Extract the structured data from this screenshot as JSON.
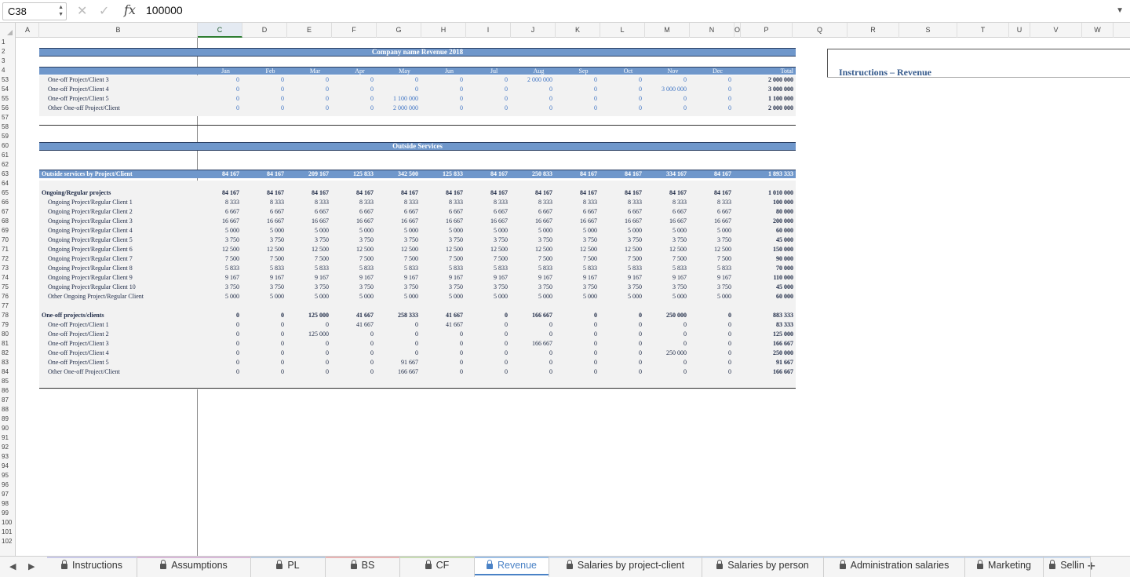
{
  "formula_bar": {
    "cell_ref": "C38",
    "value": "100000",
    "cancel_icon": "close-icon",
    "confirm_icon": "check-icon",
    "fx_label": "fx"
  },
  "columns": [
    "A",
    "B",
    "C",
    "D",
    "E",
    "F",
    "G",
    "H",
    "I",
    "J",
    "K",
    "L",
    "M",
    "N",
    "O",
    "P",
    "Q",
    "R",
    "S",
    "T",
    "U",
    "V",
    "W"
  ],
  "selected_column": "C",
  "rows": [
    "1",
    "2",
    "3",
    "4",
    "53",
    "54",
    "55",
    "56",
    "57",
    "58",
    "59",
    "60",
    "61",
    "62",
    "63",
    "64",
    "65",
    "66",
    "67",
    "68",
    "69",
    "70",
    "71",
    "72",
    "73",
    "74",
    "75",
    "76",
    "77",
    "78",
    "79",
    "80",
    "81",
    "82",
    "83",
    "84",
    "85",
    "86",
    "87",
    "88",
    "89",
    "90",
    "91",
    "92",
    "93",
    "94",
    "95",
    "96",
    "97",
    "98",
    "99",
    "100",
    "101",
    "102"
  ],
  "sheet": {
    "title": "Company name Revenue 2018",
    "months": [
      "Jan",
      "Feb",
      "Mar",
      "Apr",
      "May",
      "Jun",
      "Jul",
      "Aug",
      "Sep",
      "Oct",
      "Nov",
      "Dec",
      "Total"
    ],
    "top_rows": [
      {
        "label": "One-off Project/Client 3",
        "values": [
          "0",
          "0",
          "0",
          "0",
          "0",
          "0",
          "0",
          "2 000 000",
          "0",
          "0",
          "0",
          "0",
          "2 000 000"
        ]
      },
      {
        "label": "One-off Project/Client 4",
        "values": [
          "0",
          "0",
          "0",
          "0",
          "0",
          "0",
          "0",
          "0",
          "0",
          "0",
          "3 000 000",
          "0",
          "3 000 000"
        ]
      },
      {
        "label": "One-off Project/Client 5",
        "values": [
          "0",
          "0",
          "0",
          "0",
          "1 100 000",
          "0",
          "0",
          "0",
          "0",
          "0",
          "0",
          "0",
          "1 100 000"
        ]
      },
      {
        "label": "Other One-off Project/Client",
        "values": [
          "0",
          "0",
          "0",
          "0",
          "2 000 000",
          "0",
          "0",
          "0",
          "0",
          "0",
          "0",
          "0",
          "2 000 000"
        ]
      }
    ],
    "section2_title": "Outside Services",
    "total_row": {
      "label": "Outside services by Project/Client",
      "values": [
        "84 167",
        "84 167",
        "209 167",
        "125 833",
        "342 500",
        "125 833",
        "84 167",
        "250 833",
        "84 167",
        "84 167",
        "334 167",
        "84 167",
        "1 893 333"
      ]
    },
    "ongoing": {
      "label": "Ongoing/Regular projects",
      "values": [
        "84 167",
        "84 167",
        "84 167",
        "84 167",
        "84 167",
        "84 167",
        "84 167",
        "84 167",
        "84 167",
        "84 167",
        "84 167",
        "84 167",
        "1 010 000"
      ],
      "rows": [
        {
          "label": "Ongoing Project/Regular Client 1",
          "values": [
            "8 333",
            "8 333",
            "8 333",
            "8 333",
            "8 333",
            "8 333",
            "8 333",
            "8 333",
            "8 333",
            "8 333",
            "8 333",
            "8 333",
            "100 000"
          ]
        },
        {
          "label": "Ongoing Project/Regular Client 2",
          "values": [
            "6 667",
            "6 667",
            "6 667",
            "6 667",
            "6 667",
            "6 667",
            "6 667",
            "6 667",
            "6 667",
            "6 667",
            "6 667",
            "6 667",
            "80 000"
          ]
        },
        {
          "label": "Ongoing Project/Regular Client 3",
          "values": [
            "16 667",
            "16 667",
            "16 667",
            "16 667",
            "16 667",
            "16 667",
            "16 667",
            "16 667",
            "16 667",
            "16 667",
            "16 667",
            "16 667",
            "200 000"
          ]
        },
        {
          "label": "Ongoing Project/Regular Client 4",
          "values": [
            "5 000",
            "5 000",
            "5 000",
            "5 000",
            "5 000",
            "5 000",
            "5 000",
            "5 000",
            "5 000",
            "5 000",
            "5 000",
            "5 000",
            "60 000"
          ]
        },
        {
          "label": "Ongoing Project/Regular Client 5",
          "values": [
            "3 750",
            "3 750",
            "3 750",
            "3 750",
            "3 750",
            "3 750",
            "3 750",
            "3 750",
            "3 750",
            "3 750",
            "3 750",
            "3 750",
            "45 000"
          ]
        },
        {
          "label": "Ongoing Project/Regular Client 6",
          "values": [
            "12 500",
            "12 500",
            "12 500",
            "12 500",
            "12 500",
            "12 500",
            "12 500",
            "12 500",
            "12 500",
            "12 500",
            "12 500",
            "12 500",
            "150 000"
          ]
        },
        {
          "label": "Ongoing Project/Regular Client 7",
          "values": [
            "7 500",
            "7 500",
            "7 500",
            "7 500",
            "7 500",
            "7 500",
            "7 500",
            "7 500",
            "7 500",
            "7 500",
            "7 500",
            "7 500",
            "90 000"
          ]
        },
        {
          "label": "Ongoing Project/Regular Client 8",
          "values": [
            "5 833",
            "5 833",
            "5 833",
            "5 833",
            "5 833",
            "5 833",
            "5 833",
            "5 833",
            "5 833",
            "5 833",
            "5 833",
            "5 833",
            "70 000"
          ]
        },
        {
          "label": "Ongoing Project/Regular Client 9",
          "values": [
            "9 167",
            "9 167",
            "9 167",
            "9 167",
            "9 167",
            "9 167",
            "9 167",
            "9 167",
            "9 167",
            "9 167",
            "9 167",
            "9 167",
            "110 000"
          ]
        },
        {
          "label": "Ongoing Project/Regular Client 10",
          "values": [
            "3 750",
            "3 750",
            "3 750",
            "3 750",
            "3 750",
            "3 750",
            "3 750",
            "3 750",
            "3 750",
            "3 750",
            "3 750",
            "3 750",
            "45 000"
          ]
        },
        {
          "label": "Other Ongoing Project/Regular Client",
          "values": [
            "5 000",
            "5 000",
            "5 000",
            "5 000",
            "5 000",
            "5 000",
            "5 000",
            "5 000",
            "5 000",
            "5 000",
            "5 000",
            "5 000",
            "60 000"
          ]
        }
      ]
    },
    "oneoff": {
      "label": "One-off projects/clients",
      "values": [
        "0",
        "0",
        "125 000",
        "41 667",
        "258 333",
        "41 667",
        "0",
        "166 667",
        "0",
        "0",
        "250 000",
        "0",
        "883 333"
      ],
      "rows": [
        {
          "label": "One-off Project/Client 1",
          "values": [
            "0",
            "0",
            "0",
            "41 667",
            "0",
            "41 667",
            "0",
            "0",
            "0",
            "0",
            "0",
            "0",
            "83 333"
          ]
        },
        {
          "label": "One-off Project/Client 2",
          "values": [
            "0",
            "0",
            "125 000",
            "0",
            "0",
            "0",
            "0",
            "0",
            "0",
            "0",
            "0",
            "0",
            "125 000"
          ]
        },
        {
          "label": "One-off Project/Client 3",
          "values": [
            "0",
            "0",
            "0",
            "0",
            "0",
            "0",
            "0",
            "166 667",
            "0",
            "0",
            "0",
            "0",
            "166 667"
          ]
        },
        {
          "label": "One-off Project/Client 4",
          "values": [
            "0",
            "0",
            "0",
            "0",
            "0",
            "0",
            "0",
            "0",
            "0",
            "0",
            "250 000",
            "0",
            "250 000"
          ]
        },
        {
          "label": "One-off Project/Client 5",
          "values": [
            "0",
            "0",
            "0",
            "0",
            "91 667",
            "0",
            "0",
            "0",
            "0",
            "0",
            "0",
            "0",
            "91 667"
          ]
        },
        {
          "label": "Other One-off Project/Client",
          "values": [
            "0",
            "0",
            "0",
            "0",
            "166 667",
            "0",
            "0",
            "0",
            "0",
            "0",
            "0",
            "0",
            "166 667"
          ]
        }
      ]
    }
  },
  "instructions": {
    "title": "Instructions – Revenue"
  },
  "tabs": [
    {
      "label": "Instructions",
      "accent": "#c9c9e8"
    },
    {
      "label": "Assumptions",
      "accent": "#d8b8d8"
    },
    {
      "label": "PL",
      "accent": "#b9cbe0"
    },
    {
      "label": "BS",
      "accent": "#e8b4b4"
    },
    {
      "label": "CF",
      "accent": "#c8dcb4"
    },
    {
      "label": "Revenue",
      "accent": "#9dc0e6"
    },
    {
      "label": "Salaries by project-client",
      "accent": "#c8d8ec"
    },
    {
      "label": "Salaries by person",
      "accent": "#c8d8ec"
    },
    {
      "label": "Administration salaries",
      "accent": "#c8d8ec"
    },
    {
      "label": "Marketing",
      "accent": "#c8d8ec"
    },
    {
      "label": "Sellin",
      "accent": "#c8d8ec"
    }
  ],
  "active_tab": "Revenue",
  "add_sheet_label": "+"
}
